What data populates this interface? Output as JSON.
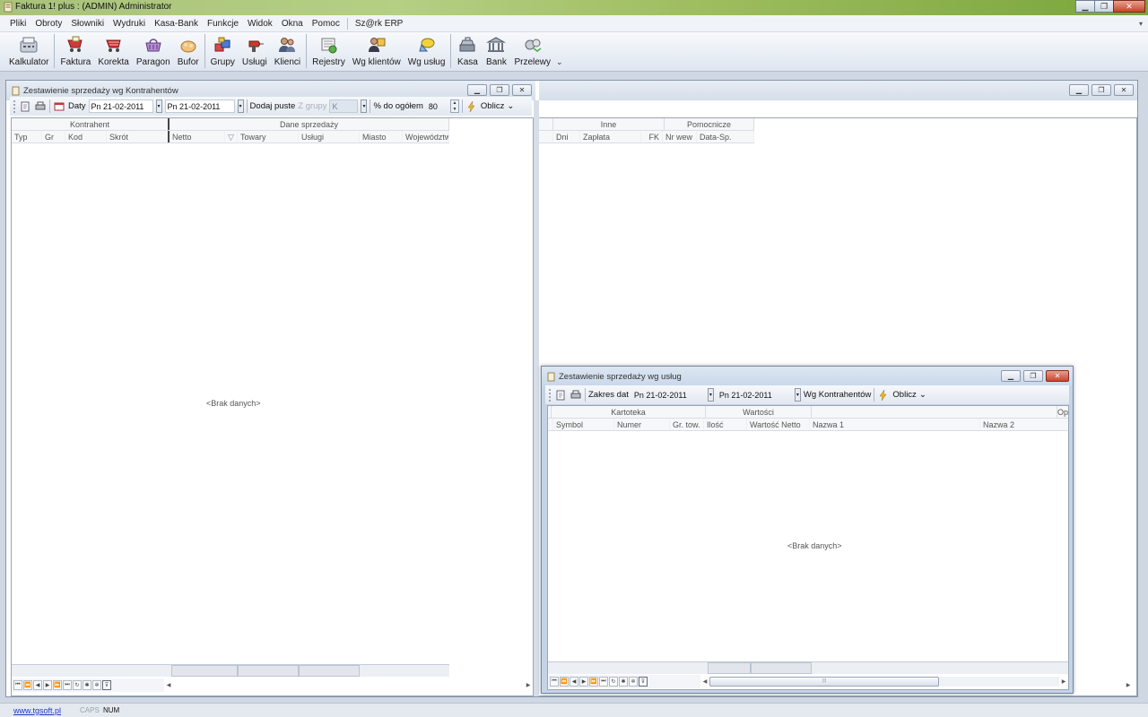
{
  "app": {
    "title": "Faktura 1! plus    : (ADMIN) Administrator"
  },
  "menu": [
    "Pliki",
    "Obroty",
    "Słowniki",
    "Wydruki",
    "Kasa-Bank",
    "Funkcje",
    "Widok",
    "Okna",
    "Pomoc",
    "Sz@rk ERP"
  ],
  "toolbar": [
    {
      "label": "Kalkulator",
      "icon": "calculator-icon"
    },
    {
      "label": "Faktura",
      "icon": "invoice-cart-icon"
    },
    {
      "label": "Korekta",
      "icon": "correction-cart-icon"
    },
    {
      "label": "Paragon",
      "icon": "receipt-basket-icon"
    },
    {
      "label": "Bufor",
      "icon": "buffer-icon"
    },
    {
      "label": "Grupy",
      "icon": "groups-icon"
    },
    {
      "label": "Usługi",
      "icon": "services-drill-icon"
    },
    {
      "label": "Klienci",
      "icon": "clients-icon"
    },
    {
      "label": "Rejestry",
      "icon": "registers-icon"
    },
    {
      "label": "Wg klientów",
      "icon": "by-clients-icon"
    },
    {
      "label": "Wg usług",
      "icon": "by-services-icon"
    },
    {
      "label": "Kasa",
      "icon": "cash-register-icon"
    },
    {
      "label": "Bank",
      "icon": "bank-icon"
    },
    {
      "label": "Przelewy",
      "icon": "transfers-icon"
    }
  ],
  "win1": {
    "title": "Zestawienie sprzedaży wg Kontrahentów",
    "dates_label": "Daty",
    "date_from": "Pn 21-02-2011",
    "date_to": "Pn 21-02-2011",
    "add_empty": "Dodaj puste",
    "from_group": "Z grupy",
    "group_value": "K",
    "percent_label": "% do ogółem",
    "percent_value": "80",
    "calc": "Oblicz",
    "bands_left": [
      "Kontrahent",
      "Dane sprzedaży"
    ],
    "columns_left": [
      "Typ",
      "Gr",
      "Kod",
      "Skrót",
      "Netto",
      "Towary",
      "Usługi",
      "Miasto",
      "Województw"
    ],
    "bands_right": [
      "Inne",
      "Pomocnicze"
    ],
    "columns_right": [
      "Dni",
      "Zapłata",
      "FK",
      "Nr wew",
      "Data-Sp."
    ],
    "no_data": "<Brak danych>"
  },
  "win2": {
    "title": "Zestawienie sprzedaży wg usług",
    "range_label": "Zakres dat",
    "date_from": "Pn 21-02-2011",
    "date_to": "Pn 21-02-2011",
    "by_clients": "Wg Kontrahentów",
    "calc": "Oblicz",
    "bands": [
      "Kartoteka",
      "Wartości",
      "Op"
    ],
    "columns": [
      "Symbol",
      "Numer",
      "Gr. tow.",
      "Ilość",
      "Wartość Netto",
      "Nazwa 1",
      "Nazwa 2"
    ],
    "no_data": "<Brak danych>"
  },
  "status": {
    "link": "www.tgsoft.pl",
    "caps": "CAPS",
    "num": "NUM"
  }
}
